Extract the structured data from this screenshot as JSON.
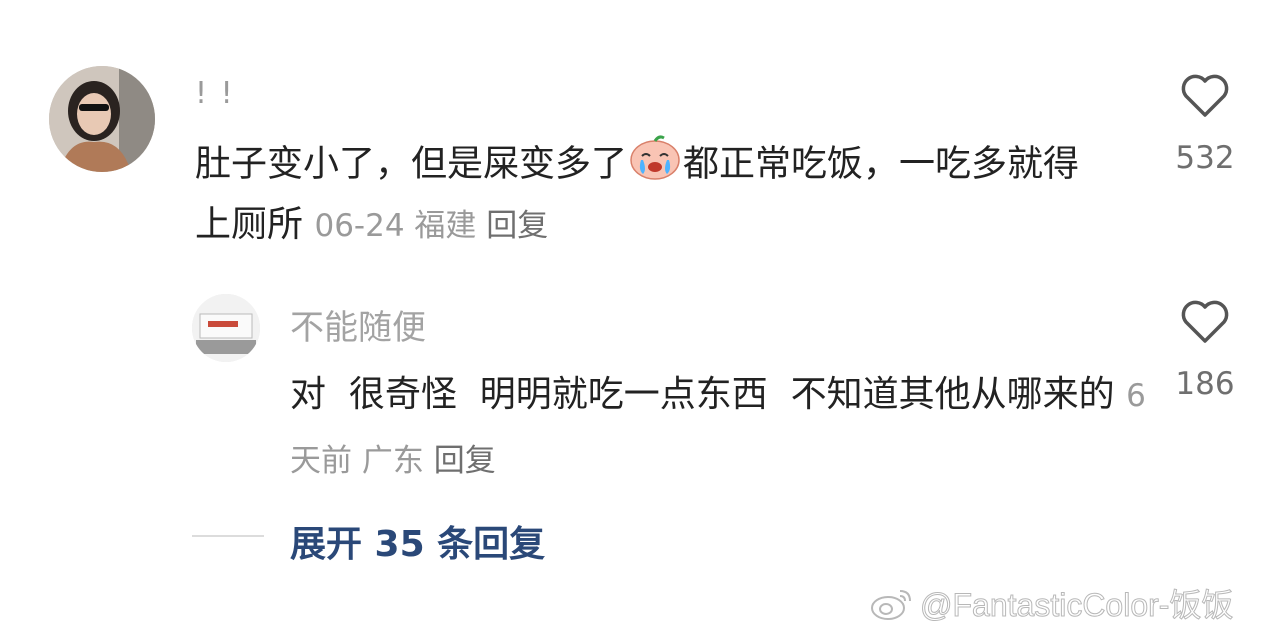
{
  "comment": {
    "username": "! !",
    "text_before_emoji": "肚子变小了，但是屎变多了",
    "emoji": "crying-face-emoji",
    "text_after_emoji": "都正常吃饭，一吃多就得上厕所",
    "date": "06-24",
    "location": "福建",
    "reply_label": "回复",
    "like_count": "532"
  },
  "reply": {
    "username": "不能随便",
    "text": "对  很奇怪  明明就吃一点东西  不知道其他从哪来的",
    "date": "6天前",
    "location": "广东",
    "reply_label": "回复",
    "like_count": "186"
  },
  "expand_label": "展开 35 条回复",
  "watermark": "@FantasticColor-饭饭",
  "colors": {
    "link": "#2a4878",
    "meta": "#9a9a9a",
    "text": "#222222"
  },
  "icons": [
    "heart-outline-icon",
    "weibo-logo-icon"
  ]
}
